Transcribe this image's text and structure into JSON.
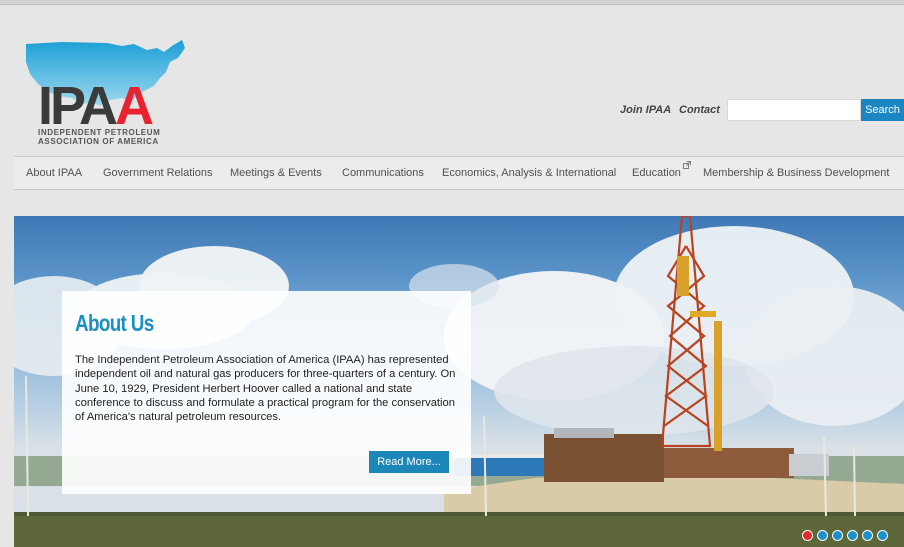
{
  "logo": {
    "wordmark": [
      "I",
      "P",
      "A",
      "A"
    ],
    "subtitle_line1": "Independent Petroleum",
    "subtitle_line2": "Association of America",
    "map_color": "#2aa6d6",
    "accent_color": "#e8232f"
  },
  "header": {
    "join_label": "Join IPAA",
    "contact_label": "Contact",
    "search_placeholder": "",
    "search_button": "Search"
  },
  "nav": {
    "items": [
      {
        "label": "About IPAA"
      },
      {
        "label": "Government Relations"
      },
      {
        "label": "Meetings & Events"
      },
      {
        "label": "Communications"
      },
      {
        "label": "Economics, Analysis & International"
      },
      {
        "label": "Education",
        "icon": "external-link-icon"
      },
      {
        "label": "Membership & Business Development"
      }
    ]
  },
  "hero": {
    "title": "About Us",
    "body": "The Independent Petroleum Association of America (IPAA) has represented independent oil and natural gas producers for three-quarters of a century. On June 10, 1929, President Herbert Hoover called a national and state conference to discuss and formulate a practical program for the conservation of America's natural petroleum resources.",
    "read_more": "Read More...",
    "slide_count": 6,
    "active_slide": 1
  },
  "colors": {
    "brand_blue": "#1b86b8",
    "active_dot": "#e02b2b"
  }
}
